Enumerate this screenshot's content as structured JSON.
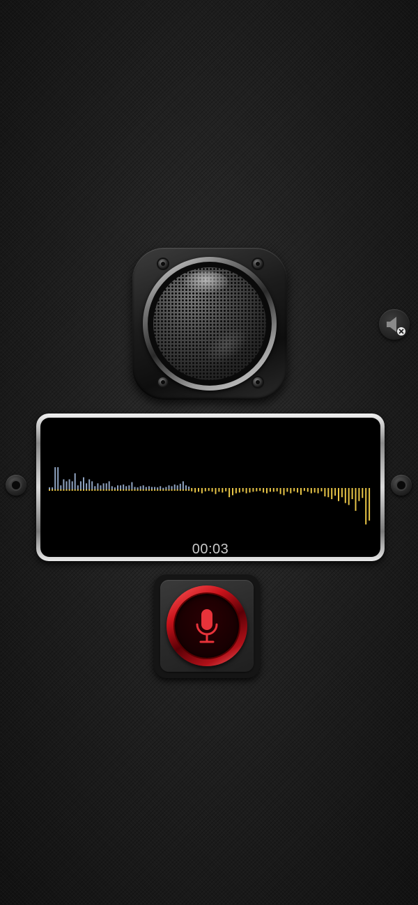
{
  "app": {
    "accent_color": "#e0262e",
    "waveform_color_recorded": "#8fa3c0",
    "waveform_color_live": "#e8c547"
  },
  "speaker": {
    "icon": "speaker-grille-icon"
  },
  "mute_button": {
    "icon": "speaker-muted-icon",
    "state": "muted"
  },
  "waveform": {
    "timer": "00:03",
    "playhead_fraction": 0.44,
    "recorded_levels": [
      0.05,
      0.05,
      0.55,
      0.55,
      0.1,
      0.25,
      0.2,
      0.25,
      0.2,
      0.4,
      0.1,
      0.2,
      0.3,
      0.15,
      0.25,
      0.2,
      0.08,
      0.15,
      0.1,
      0.15,
      0.15,
      0.2,
      0.08,
      0.05,
      0.1,
      0.1,
      0.12,
      0.08,
      0.1,
      0.18,
      0.06,
      0.05,
      0.08,
      0.1,
      0.06,
      0.08,
      0.06,
      0.06,
      0.05,
      0.08,
      0.04,
      0.06,
      0.1,
      0.08,
      0.12,
      0.1,
      0.14,
      0.2,
      0.1,
      0.07
    ],
    "live_levels": [
      0.05,
      0.08,
      0.06,
      0.1,
      0.05,
      0.04,
      0.06,
      0.12,
      0.06,
      0.08,
      0.05,
      0.2,
      0.15,
      0.1,
      0.08,
      0.06,
      0.1,
      0.08,
      0.06,
      0.05,
      0.04,
      0.08,
      0.1,
      0.06,
      0.06,
      0.05,
      0.12,
      0.15,
      0.06,
      0.1,
      0.05,
      0.08,
      0.14,
      0.04,
      0.06,
      0.1,
      0.08,
      0.1,
      0.05,
      0.18,
      0.2,
      0.25,
      0.16,
      0.3,
      0.2,
      0.35,
      0.4,
      0.25,
      0.55,
      0.3,
      0.22,
      0.9,
      0.8
    ]
  },
  "record_button": {
    "icon": "microphone-icon",
    "state": "recording"
  }
}
